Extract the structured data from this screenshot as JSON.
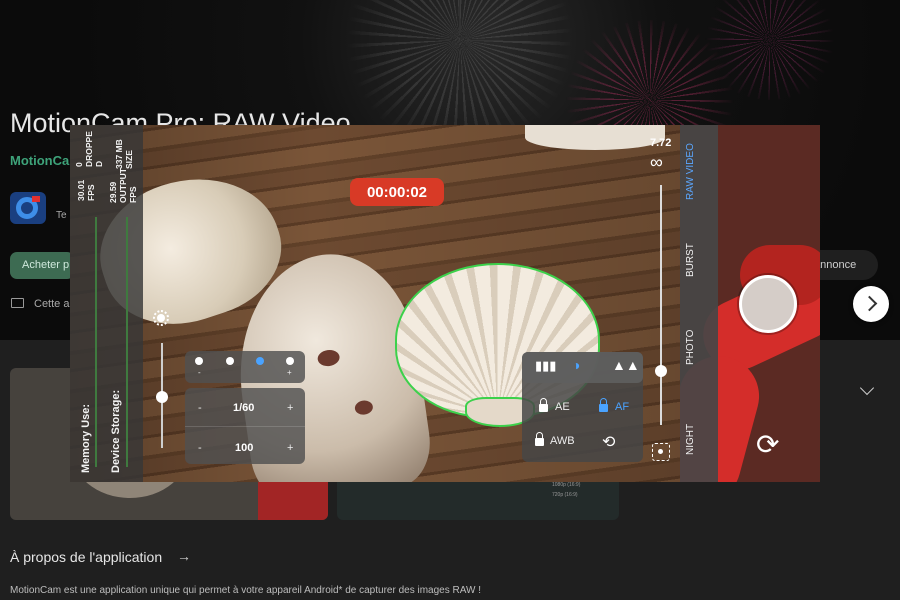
{
  "store": {
    "app_title": "MotionCam Pro: RAW Video",
    "developer": "MotionCam",
    "icon_caption": "Te",
    "buy_label": "Acheter p",
    "annonce_label": "annonce",
    "device_text": "Cette a",
    "about_heading": "À propos de l'application",
    "about_arrow": "→",
    "about_text": "MotionCam est une application unique qui permet à votre appareil Android* de capturer des images RAW !",
    "shot_options": [
      "1080p (16:9)",
      "720p (16:9)"
    ]
  },
  "camera": {
    "stats": {
      "dropped_value": "0",
      "dropped_label_1": "DROPPE",
      "dropped_label_2": "D",
      "size_value": "337 MB",
      "size_label": "SIZE",
      "fps_value": "30.01",
      "fps_label": "FPS",
      "output_fps_value": "29.59",
      "output_fps_label_1": "OUTPUT",
      "output_fps_label_2": "FPS"
    },
    "memory_label": "Memory Use:",
    "storage_label": "Device Storage:",
    "timer": "00:00:02",
    "exposure": {
      "minus": "-",
      "plus": "+",
      "shutter_speed": "1/60",
      "iso": "100",
      "ev_selected_index": 2
    },
    "controls": {
      "ae_label": "AE",
      "af_label": "AF",
      "awb_label": "AWB",
      "histogram_icon": "histogram-icon",
      "hdr_icon": "hdr-icon",
      "landscape_icon": "landscape-icon",
      "reset_icon": "reset-icon",
      "af_locked_color": "#4aa3ff"
    },
    "zoom_value": "7.72",
    "focus_infinity": "∞",
    "modes": [
      "RAW VIDEO",
      "BURST",
      "PHOTO",
      "NIGHT"
    ],
    "active_mode": "RAW VIDEO",
    "accent_color": "#d83a26"
  }
}
